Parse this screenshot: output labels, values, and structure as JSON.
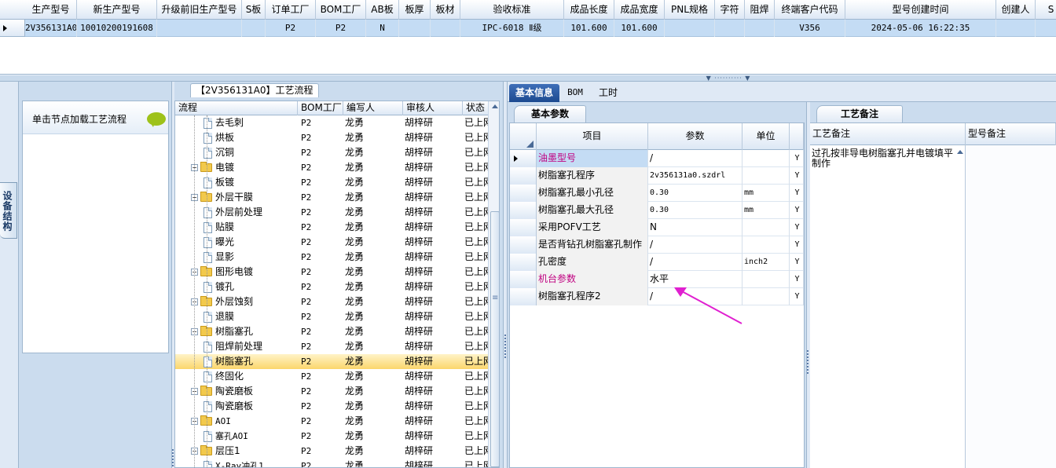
{
  "top_grid": {
    "headers": [
      {
        "label": "生产型号",
        "w": 66
      },
      {
        "label": "新生产型号",
        "w": 102
      },
      {
        "label": "升级前旧生产型号",
        "w": 108
      },
      {
        "label": "S板",
        "w": 30
      },
      {
        "label": "订单工厂",
        "w": 64
      },
      {
        "label": "BOM工厂",
        "w": 64
      },
      {
        "label": "AB板",
        "w": 42
      },
      {
        "label": "板厚",
        "w": 40
      },
      {
        "label": "板材",
        "w": 38
      },
      {
        "label": "验收标准",
        "w": 132
      },
      {
        "label": "成品长度",
        "w": 64
      },
      {
        "label": "成品宽度",
        "w": 64
      },
      {
        "label": "PNL规格",
        "w": 64
      },
      {
        "label": "字符",
        "w": 38
      },
      {
        "label": "阻焊",
        "w": 38
      },
      {
        "label": "终端客户代码",
        "w": 90
      },
      {
        "label": "型号创建时间",
        "w": 192
      },
      {
        "label": "创建人",
        "w": 50
      },
      {
        "label": "S",
        "w": 40
      }
    ],
    "row": [
      "2V356131A0",
      "10010200191608",
      "",
      "",
      "P2",
      "P2",
      "N",
      "",
      "",
      "IPC-6018 Ⅱ级",
      "101.600",
      "101.600",
      "",
      "",
      "",
      "V356",
      "2024-05-06 16:22:35",
      "",
      ""
    ]
  },
  "left_strip": {
    "vertical_tab": "设备结构"
  },
  "load_panel": {
    "button_label": "单击节点加载工艺流程"
  },
  "tree": {
    "title": "【2V356131A0】工艺流程",
    "columns": [
      "流程",
      "BOM工厂",
      "编写人",
      "审核人",
      "状态"
    ],
    "rows": [
      {
        "name": "去毛刺",
        "level": 1,
        "type": "doc",
        "bom": "P2",
        "writer": "龙勇",
        "auditor": "胡梓研",
        "status": "已上网"
      },
      {
        "name": "烘板",
        "level": 1,
        "type": "doc",
        "bom": "P2",
        "writer": "龙勇",
        "auditor": "胡梓研",
        "status": "已上网"
      },
      {
        "name": "沉铜",
        "level": 1,
        "type": "doc",
        "bom": "P2",
        "writer": "龙勇",
        "auditor": "胡梓研",
        "status": "已上网"
      },
      {
        "name": "电镀",
        "level": 0,
        "type": "folder",
        "bom": "P2",
        "writer": "龙勇",
        "auditor": "胡梓研",
        "status": "已上网"
      },
      {
        "name": "板镀",
        "level": 1,
        "type": "doc",
        "bom": "P2",
        "writer": "龙勇",
        "auditor": "胡梓研",
        "status": "已上网"
      },
      {
        "name": "外层干膜",
        "level": 0,
        "type": "folder",
        "bom": "P2",
        "writer": "龙勇",
        "auditor": "胡梓研",
        "status": "已上网"
      },
      {
        "name": "外层前处理",
        "level": 1,
        "type": "doc",
        "bom": "P2",
        "writer": "龙勇",
        "auditor": "胡梓研",
        "status": "已上网"
      },
      {
        "name": "贴膜",
        "level": 1,
        "type": "doc",
        "bom": "P2",
        "writer": "龙勇",
        "auditor": "胡梓研",
        "status": "已上网"
      },
      {
        "name": "曝光",
        "level": 1,
        "type": "doc",
        "bom": "P2",
        "writer": "龙勇",
        "auditor": "胡梓研",
        "status": "已上网"
      },
      {
        "name": "显影",
        "level": 1,
        "type": "doc",
        "bom": "P2",
        "writer": "龙勇",
        "auditor": "胡梓研",
        "status": "已上网"
      },
      {
        "name": "图形电镀",
        "level": 0,
        "type": "folder",
        "bom": "P2",
        "writer": "龙勇",
        "auditor": "胡梓研",
        "status": "已上网"
      },
      {
        "name": "镀孔",
        "level": 1,
        "type": "doc",
        "bom": "P2",
        "writer": "龙勇",
        "auditor": "胡梓研",
        "status": "已上网"
      },
      {
        "name": "外层蚀刻",
        "level": 0,
        "type": "folder",
        "bom": "P2",
        "writer": "龙勇",
        "auditor": "胡梓研",
        "status": "已上网"
      },
      {
        "name": "退膜",
        "level": 1,
        "type": "doc",
        "bom": "P2",
        "writer": "龙勇",
        "auditor": "胡梓研",
        "status": "已上网"
      },
      {
        "name": "树脂塞孔",
        "level": 0,
        "type": "folder",
        "bom": "P2",
        "writer": "龙勇",
        "auditor": "胡梓研",
        "status": "已上网"
      },
      {
        "name": "阻焊前处理",
        "level": 1,
        "type": "doc",
        "bom": "P2",
        "writer": "龙勇",
        "auditor": "胡梓研",
        "status": "已上网"
      },
      {
        "name": "树脂塞孔",
        "level": 1,
        "type": "doc",
        "bom": "P2",
        "writer": "龙勇",
        "auditor": "胡梓研",
        "status": "已上网",
        "selected": true
      },
      {
        "name": "终固化",
        "level": 1,
        "type": "doc",
        "bom": "P2",
        "writer": "龙勇",
        "auditor": "胡梓研",
        "status": "已上网"
      },
      {
        "name": "陶瓷磨板",
        "level": 0,
        "type": "folder",
        "bom": "P2",
        "writer": "龙勇",
        "auditor": "胡梓研",
        "status": "已上网"
      },
      {
        "name": "陶瓷磨板",
        "level": 1,
        "type": "doc",
        "bom": "P2",
        "writer": "龙勇",
        "auditor": "胡梓研",
        "status": "已上网"
      },
      {
        "name": "AOI",
        "level": 0,
        "type": "folder",
        "bom": "P2",
        "writer": "龙勇",
        "auditor": "胡梓研",
        "status": "已上网"
      },
      {
        "name": "塞孔AOI",
        "level": 1,
        "type": "doc",
        "bom": "P2",
        "writer": "龙勇",
        "auditor": "胡梓研",
        "status": "已上网"
      },
      {
        "name": "层压1",
        "level": 0,
        "type": "folder",
        "bom": "P2",
        "writer": "龙勇",
        "auditor": "胡梓研",
        "status": "已上网"
      },
      {
        "name": "X-Ray冲孔1",
        "level": 1,
        "type": "doc",
        "bom": "P2",
        "writer": "龙勇",
        "auditor": "胡梓研",
        "status": "已上网"
      }
    ]
  },
  "main_tabs": [
    "基本信息",
    "BOM",
    "工时"
  ],
  "params": {
    "tab": "基本参数",
    "columns": [
      "项目",
      "参数",
      "单位"
    ],
    "rows": [
      {
        "item": "油墨型号",
        "value": "/",
        "unit": "",
        "flag": "Y",
        "highlight": true,
        "current": true
      },
      {
        "item": "树脂塞孔程序",
        "value": "2v356131a0.szdrl",
        "unit": "",
        "flag": "Y"
      },
      {
        "item": "树脂塞孔最小孔径",
        "value": "0.30",
        "unit": "mm",
        "flag": "Y"
      },
      {
        "item": "树脂塞孔最大孔径",
        "value": "0.30",
        "unit": "mm",
        "flag": "Y"
      },
      {
        "item": "采用POFV工艺",
        "value": "N",
        "unit": "",
        "flag": "Y"
      },
      {
        "item": "是否背钻孔树脂塞孔制作",
        "value": "/",
        "unit": "",
        "flag": "Y"
      },
      {
        "item": "孔密度",
        "value": "/",
        "unit": "inch2",
        "flag": "Y"
      },
      {
        "item": "机台参数",
        "value": "水平",
        "unit": "",
        "flag": "Y",
        "highlight": true
      },
      {
        "item": "树脂塞孔程序2",
        "value": "/",
        "unit": "",
        "flag": "Y"
      }
    ]
  },
  "notes": {
    "tab": "工艺备注",
    "columns": [
      "工艺备注",
      "型号备注"
    ],
    "text": "过孔按非导电树脂塞孔并电镀填平制作"
  },
  "colors": {
    "accent": "#1c4a90",
    "selection": "#c4dcf4",
    "highlight_text": "#c00080",
    "arrow": "#e020d0"
  }
}
